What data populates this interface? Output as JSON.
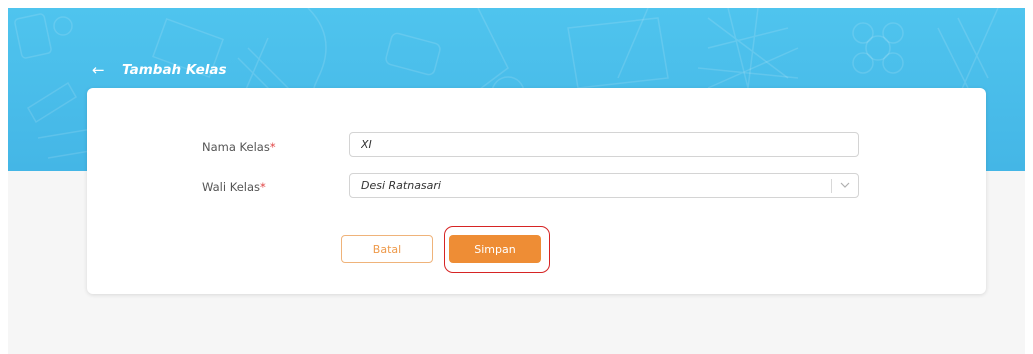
{
  "header": {
    "back_icon": "←",
    "title": "Tambah Kelas"
  },
  "form": {
    "nama_kelas": {
      "label": "Nama Kelas",
      "required_mark": "*",
      "value": "XI"
    },
    "wali_kelas": {
      "label": "Wali Kelas",
      "required_mark": "*",
      "selected": "Desi Ratnasari"
    }
  },
  "actions": {
    "cancel_label": "Batal",
    "save_label": "Simpan"
  },
  "colors": {
    "header_blue": "#4fc4ee",
    "accent_orange": "#ee8d35",
    "highlight_red": "#d62424",
    "required_red": "#e04545"
  },
  "icons": {
    "back": "arrow-left-icon",
    "dropdown": "chevron-down-icon"
  }
}
